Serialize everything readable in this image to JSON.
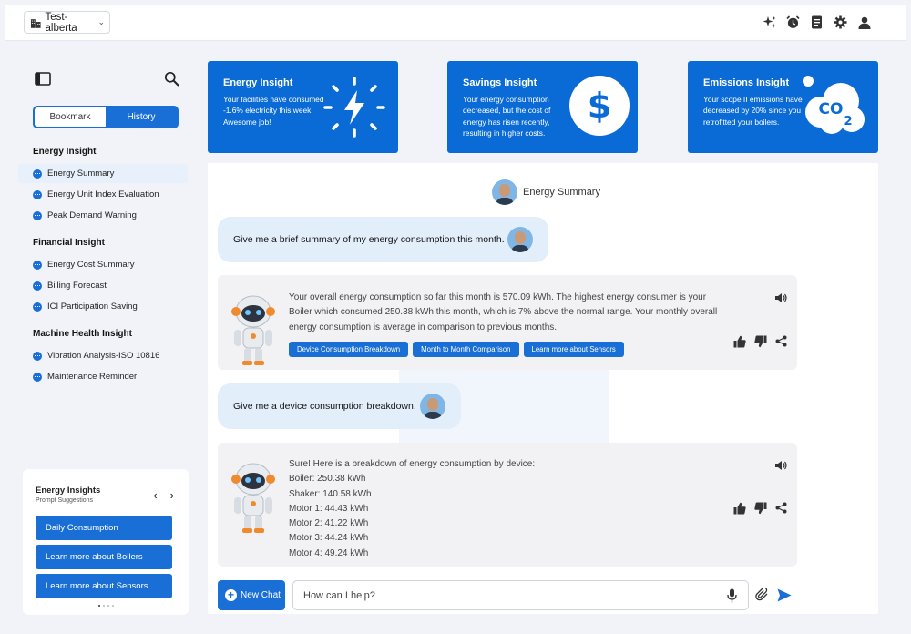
{
  "header": {
    "site_name": "Test-alberta",
    "icons": [
      "sparkle-icon",
      "alarm-clock-icon",
      "document-icon",
      "settings-gear-icon",
      "user-icon"
    ]
  },
  "sidebar": {
    "tabs": {
      "bookmark": "Bookmark",
      "history": "History",
      "selected": "Bookmark"
    },
    "groups": [
      {
        "title": "Energy Insight",
        "items": [
          "Energy Summary",
          "Energy Unit Index Evaluation",
          "Peak Demand Warning"
        ]
      },
      {
        "title": "Financial Insight",
        "items": [
          "Energy Cost Summary",
          "Billing Forecast",
          "ICI Participation Saving"
        ]
      },
      {
        "title": "Machine Health Insight",
        "items": [
          "Vibration Analysis-ISO 10816",
          "Maintenance Reminder"
        ]
      }
    ],
    "selected_item": "Energy Summary"
  },
  "suggestions": {
    "title": "Energy Insights",
    "subtitle": "Prompt Suggestions",
    "buttons": [
      "Daily Consumption",
      "Learn more about Boilers",
      "Learn more about Sensors"
    ]
  },
  "cards": [
    {
      "title": "Energy Insight",
      "text": "Your facilities have consumed -1.6% electricity this week! Awesome job!"
    },
    {
      "title": "Savings Insight",
      "text": "Your energy consumption decreased, but the cost of energy has risen recently, resulting in higher costs."
    },
    {
      "title": "Emissions Insight",
      "text": "Your scope II emissions have decreased by 20% since you retrofitted your boilers."
    }
  ],
  "chat": {
    "title": "Energy Summary",
    "messages": [
      {
        "role": "user",
        "text": "Give me a brief summary of my energy consumption this month."
      },
      {
        "role": "bot",
        "lines": [
          "Your overall energy consumption so far this month is 570.09 kWh.  The highest energy consumer is your",
          "Boiler which consumed 250.38 kWh this month, which is 7%  above the normal range. Your monthly overall",
          "energy consumption is average in comparison to previous months."
        ],
        "chips": [
          "Device Consumption Breakdown",
          "Month to Month Comparison",
          "Learn more about Sensors"
        ]
      },
      {
        "role": "user",
        "text": "Give me a device consumption breakdown."
      },
      {
        "role": "bot",
        "lines": [
          "Sure! Here is a breakdown of energy consumption by device:",
          "Boiler: 250.38 kWh",
          "Shaker: 140.58 kWh",
          "Motor 1: 44.43 kWh",
          "Motor 2: 41.22 kWh",
          "Motor 3: 44.24 kWh",
          "Motor 4: 49.24 kWh"
        ]
      }
    ],
    "new_chat_label": "New Chat",
    "input_placeholder": "How can I help?"
  },
  "colors": {
    "primary": "#0a6ad6",
    "user_bubble": "#e3eefb",
    "bot_bubble": "#f2f2f4",
    "background": "#f1f3f9"
  }
}
